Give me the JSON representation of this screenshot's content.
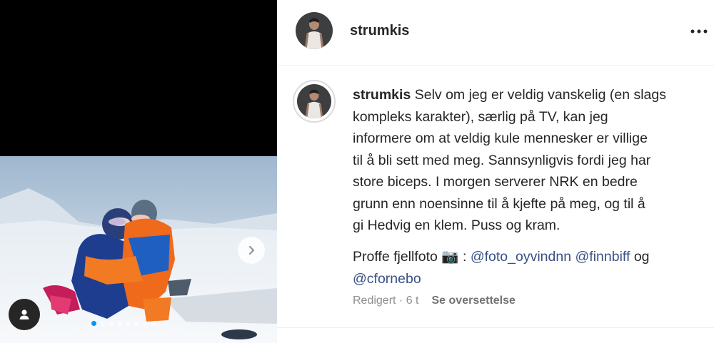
{
  "post": {
    "username": "strumkis",
    "more_options": "•••",
    "caption_lines": [
      "Selv om jeg er veldig vanskelig (en slags",
      "kompleks karakter), særlig på TV, kan jeg",
      "informere om at veldig kule mennesker er villige",
      "til å bli sett med meg. Sannsynligvis fordi jeg har",
      "store biceps. I morgen serverer NRK en bedre",
      "grunn enn noensinne til å kjefte på meg, og til å",
      "gi Hedvig en klem. Puss og kram."
    ],
    "credits_prefix": "Proffe fjellfoto 📷 : ",
    "mentions": [
      "@foto_oyvindnn",
      "@finnbiff",
      "@cfornebo"
    ],
    "credits_joiner": "og",
    "edited_label": "Redigert",
    "time_ago": "6 t",
    "translate_label": "Se oversettelse"
  },
  "media": {
    "carousel_count": 8,
    "active_index": 0,
    "next_icon": "chevron-right-icon",
    "tag_icon": "user-icon"
  },
  "colors": {
    "accent": "#0095f6",
    "mention": "#385185",
    "muted": "#8e8e8e"
  }
}
